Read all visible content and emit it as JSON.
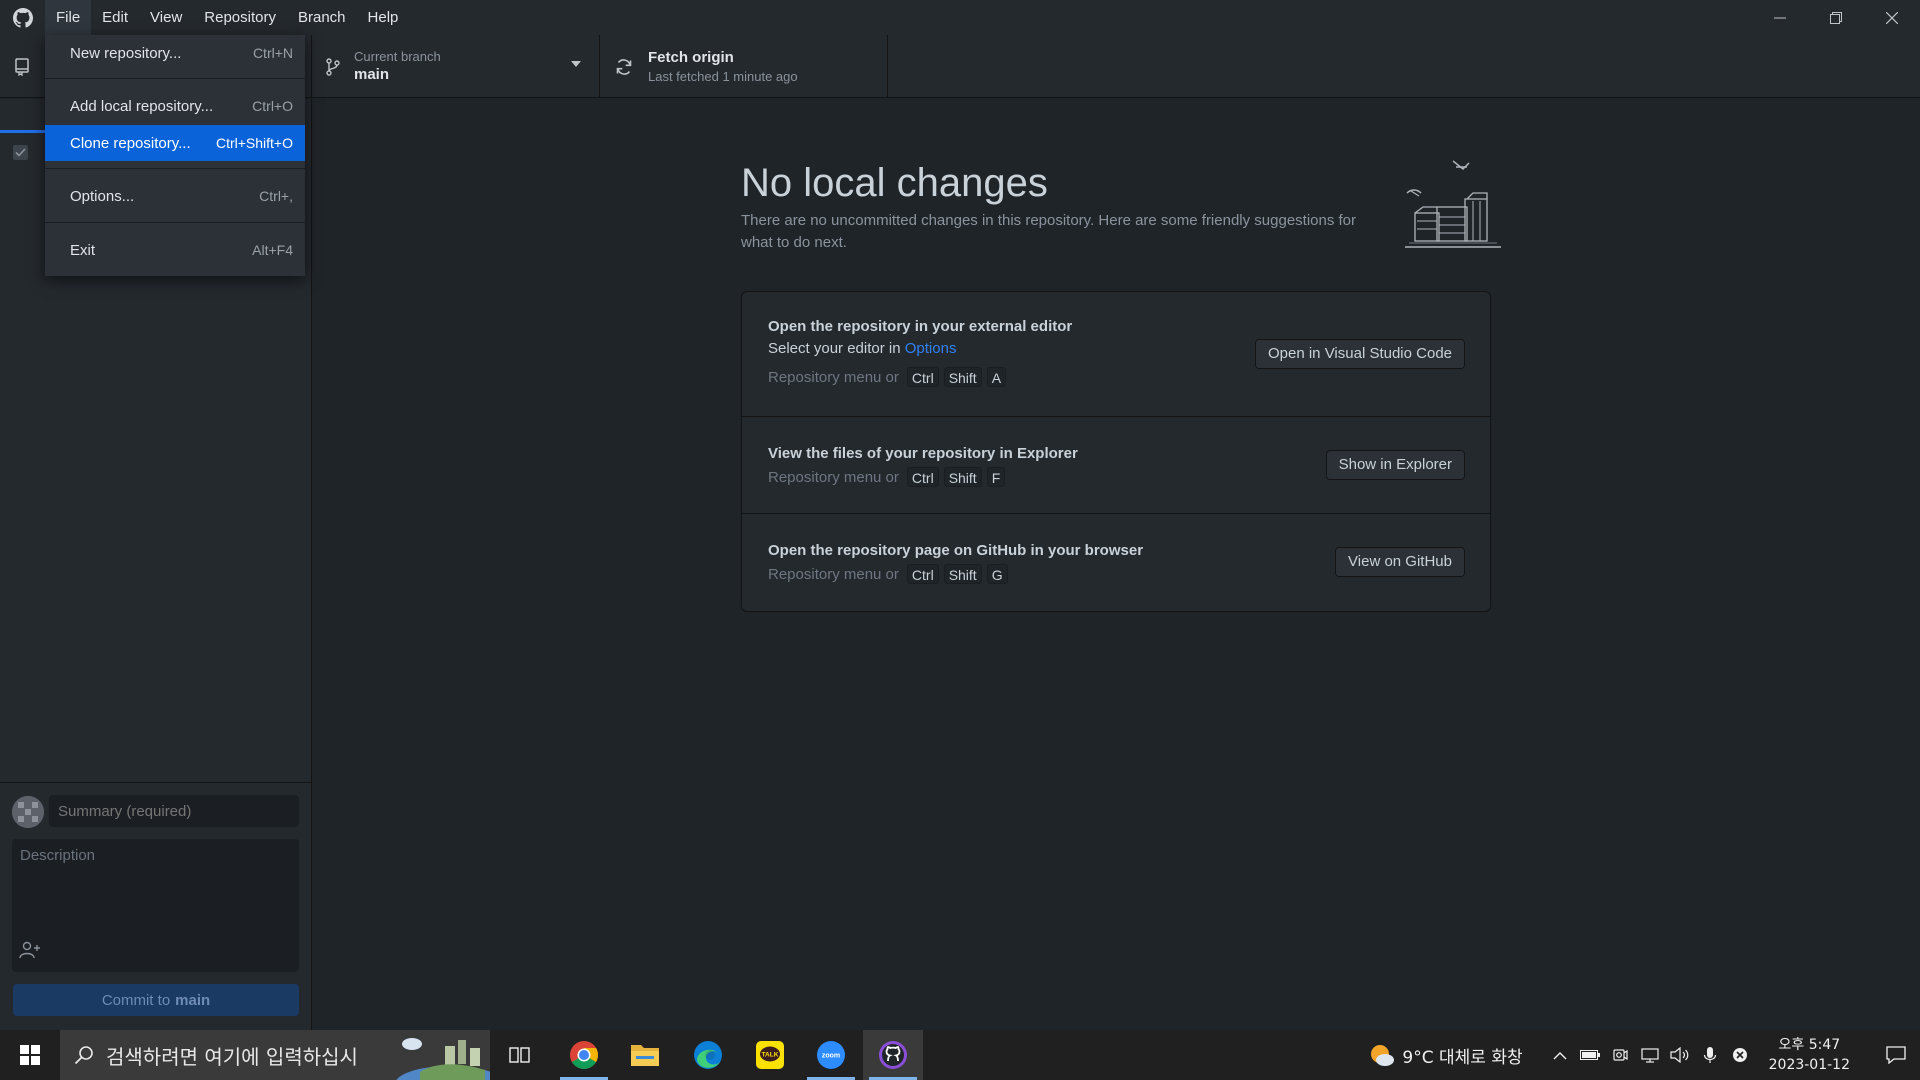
{
  "menubar": {
    "items": [
      "File",
      "Edit",
      "View",
      "Repository",
      "Branch",
      "Help"
    ]
  },
  "toolbar": {
    "branch_label": "Current branch",
    "branch_name": "main",
    "fetch_title": "Fetch origin",
    "fetch_sub": "Last fetched 1 minute ago"
  },
  "file_menu": {
    "items": [
      {
        "label": "New repository...",
        "shortcut": "Ctrl+N"
      },
      {
        "label": "Add local repository...",
        "shortcut": "Ctrl+O"
      },
      {
        "label": "Clone repository...",
        "shortcut": "Ctrl+Shift+O"
      },
      {
        "label": "Options...",
        "shortcut": "Ctrl+,"
      },
      {
        "label": "Exit",
        "shortcut": "Alt+F4"
      }
    ],
    "highlighted": "Clone repository..."
  },
  "commit": {
    "summary_placeholder": "Summary (required)",
    "description_placeholder": "Description",
    "button_prefix": "Commit to",
    "button_branch": "main"
  },
  "main": {
    "headline": "No local changes",
    "subline": "There are no uncommitted changes in this repository. Here are some friendly suggestions for what to do next.",
    "cards": [
      {
        "title": "Open the repository in your external editor",
        "sub_prefix": "Select your editor in",
        "sub_link": "Options",
        "hint": "Repository menu or",
        "keys": [
          "Ctrl",
          "Shift",
          "A"
        ],
        "button": "Open in Visual Studio Code"
      },
      {
        "title": "View the files of your repository in Explorer",
        "hint": "Repository menu or",
        "keys": [
          "Ctrl",
          "Shift",
          "F"
        ],
        "button": "Show in Explorer"
      },
      {
        "title": "Open the repository page on GitHub in your browser",
        "hint": "Repository menu or",
        "keys": [
          "Ctrl",
          "Shift",
          "G"
        ],
        "button": "View on GitHub"
      }
    ]
  },
  "taskbar": {
    "search_placeholder": "검색하려면 여기에 입력하십시",
    "apps": [
      "task-view",
      "chrome",
      "file-explorer",
      "edge",
      "kakaotalk",
      "zoom",
      "github-desktop"
    ],
    "weather": "9°C  대체로 화창",
    "time": "오후 5:47",
    "date": "2023-01-12"
  },
  "colors": {
    "background": "#1f2428",
    "panel": "#24292e",
    "highlight": "#0a63d8",
    "link": "#2f81f7",
    "commit_button": "#1b3a63"
  }
}
